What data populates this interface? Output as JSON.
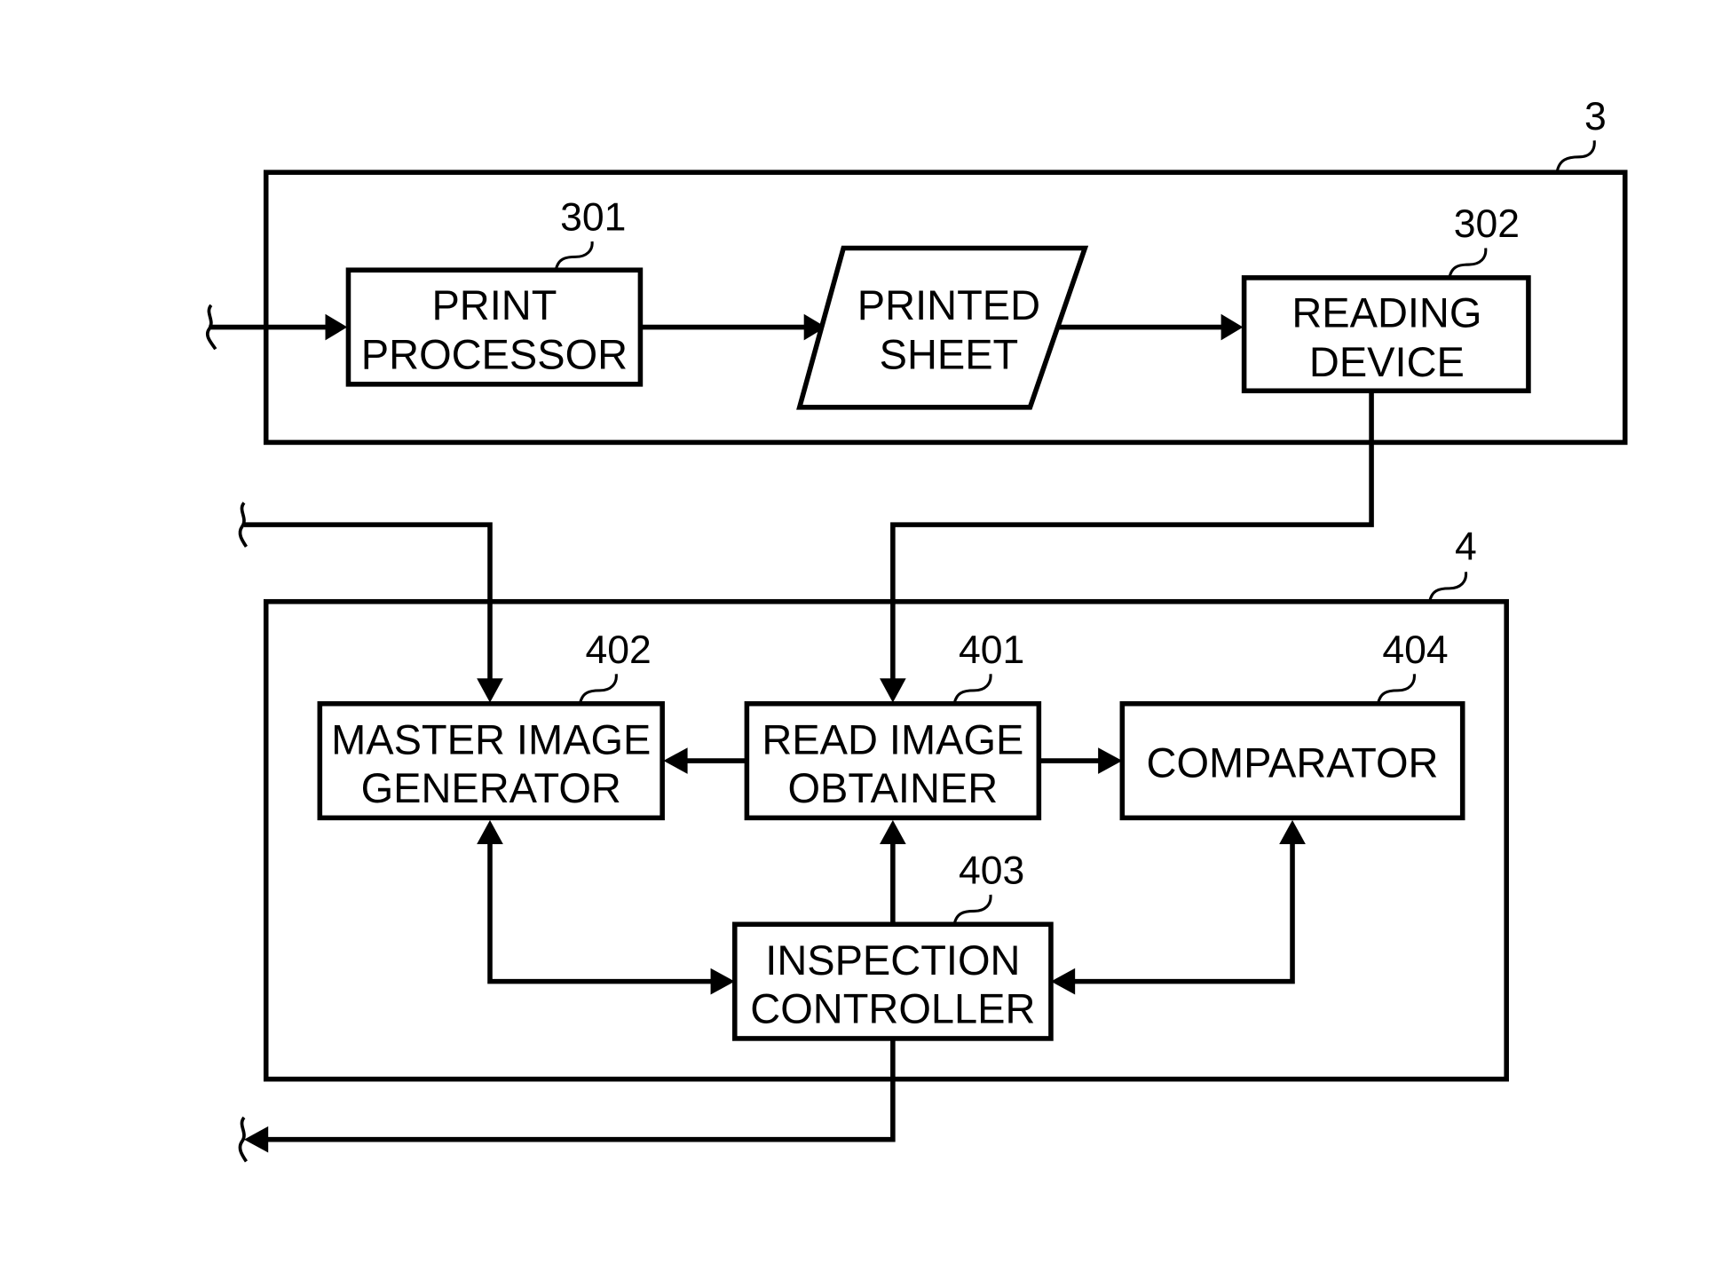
{
  "diagram": {
    "groups": [
      {
        "id": "3",
        "ref": "3"
      },
      {
        "id": "4",
        "ref": "4"
      }
    ],
    "blocks": {
      "print_processor": {
        "ref": "301",
        "lines": [
          "PRINT",
          "PROCESSOR"
        ]
      },
      "printed_sheet": {
        "lines": [
          "PRINTED",
          "SHEET"
        ]
      },
      "reading_device": {
        "ref": "302",
        "lines": [
          "READING",
          "DEVICE"
        ]
      },
      "master_image_generator": {
        "ref": "402",
        "lines": [
          "MASTER IMAGE",
          "GENERATOR"
        ]
      },
      "read_image_obtainer": {
        "ref": "401",
        "lines": [
          "READ IMAGE",
          "OBTAINER"
        ]
      },
      "comparator": {
        "ref": "404",
        "lines": [
          "COMPARATOR"
        ]
      },
      "inspection_controller": {
        "ref": "403",
        "lines": [
          "INSPECTION",
          "CONTROLLER"
        ]
      }
    },
    "connections": [
      {
        "from": "external-input",
        "to": "print_processor"
      },
      {
        "from": "print_processor",
        "to": "printed_sheet"
      },
      {
        "from": "printed_sheet",
        "to": "reading_device"
      },
      {
        "from": "reading_device",
        "to": "read_image_obtainer"
      },
      {
        "from": "external-input",
        "to": "master_image_generator"
      },
      {
        "from": "read_image_obtainer",
        "to": "master_image_generator"
      },
      {
        "from": "read_image_obtainer",
        "to": "comparator"
      },
      {
        "from": "inspection_controller",
        "to": "master_image_generator",
        "bidirectional": true
      },
      {
        "from": "inspection_controller",
        "to": "read_image_obtainer"
      },
      {
        "from": "inspection_controller",
        "to": "comparator",
        "bidirectional": true
      },
      {
        "from": "inspection_controller",
        "to": "external-output"
      }
    ]
  }
}
